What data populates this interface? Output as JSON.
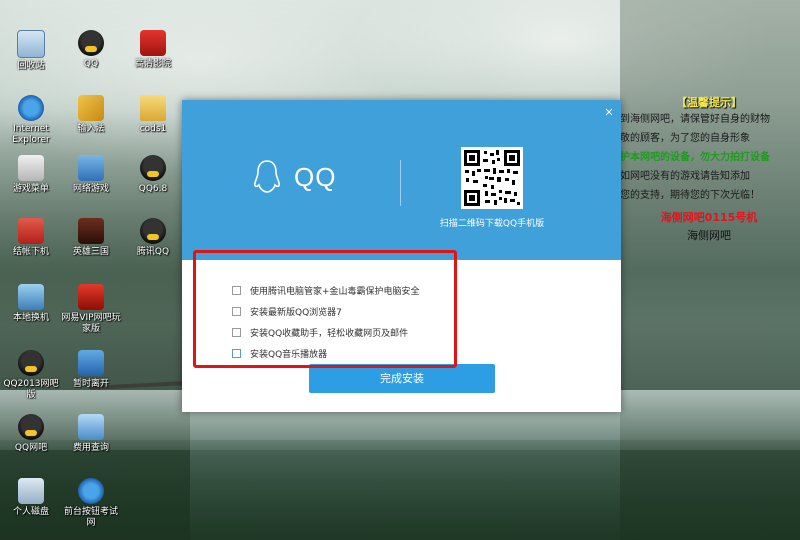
{
  "desktop": {
    "icons": [
      {
        "label": "回收站",
        "icon": "recycle-bin-icon"
      },
      {
        "label": "QQ",
        "icon": "qq-penguin-icon"
      },
      {
        "label": "高清影院",
        "icon": "video-player-icon"
      },
      {
        "label": "Internet Explorer",
        "icon": "internet-explorer-icon"
      },
      {
        "label": "输入法",
        "icon": "input-method-icon"
      },
      {
        "label": "cods1",
        "icon": "folder-icon"
      },
      {
        "label": "游戏菜单",
        "icon": "game-menu-icon"
      },
      {
        "label": "网络游戏",
        "icon": "online-games-icon"
      },
      {
        "label": "QQ6.8",
        "icon": "qq-penguin-icon"
      },
      {
        "label": "结帐下机",
        "icon": "power-icon"
      },
      {
        "label": "英雄三国",
        "icon": "game-icon"
      },
      {
        "label": "腾讯QQ",
        "icon": "qq-penguin-icon"
      },
      {
        "label": "本地换机",
        "icon": "computer-icon"
      },
      {
        "label": "网易VIP网吧玩家版",
        "icon": "vip-icon"
      },
      {
        "label": "QQ2013网吧版",
        "icon": "qq-penguin-icon"
      },
      {
        "label": "暂时离开",
        "icon": "lock-icon"
      },
      {
        "label": "QQ网吧",
        "icon": "qq-penguin-icon"
      },
      {
        "label": "费用查询",
        "icon": "search-icon"
      },
      {
        "label": "个人磁盘",
        "icon": "disk-icon"
      },
      {
        "label": "前台按钮考试网",
        "icon": "internet-explorer-icon"
      }
    ]
  },
  "notice": {
    "title": "【温馨提示】",
    "lines": [
      "到海侧网吧，请保管好自身的财物",
      "敬的顾客，为了您的自身形象",
      "护本网吧的设备，勿大力拍打设备",
      "如网吧没有的游戏请告知添加",
      "您的支持，期待您的下次光临！"
    ],
    "highlight_line": "海侧网吧0115号机",
    "footer": "海侧网吧"
  },
  "dialog": {
    "close_symbol": "✕",
    "logo_text": "QQ",
    "qr_caption": "扫描二维码下载QQ手机版",
    "options": [
      {
        "label": "使用腾讯电脑管家+金山毒霸保护电脑安全",
        "checked": false
      },
      {
        "label": "安装最新版QQ浏览器7",
        "checked": false
      },
      {
        "label": "安装QQ收藏助手，轻松收藏网页及邮件",
        "checked": false
      },
      {
        "label": "安装QQ音乐播放器",
        "checked": false
      }
    ],
    "finish_button": "完成安装"
  },
  "colors": {
    "dialog_header": "#3fa0da",
    "button": "#2d9ee3",
    "highlight_border": "#e01414"
  }
}
